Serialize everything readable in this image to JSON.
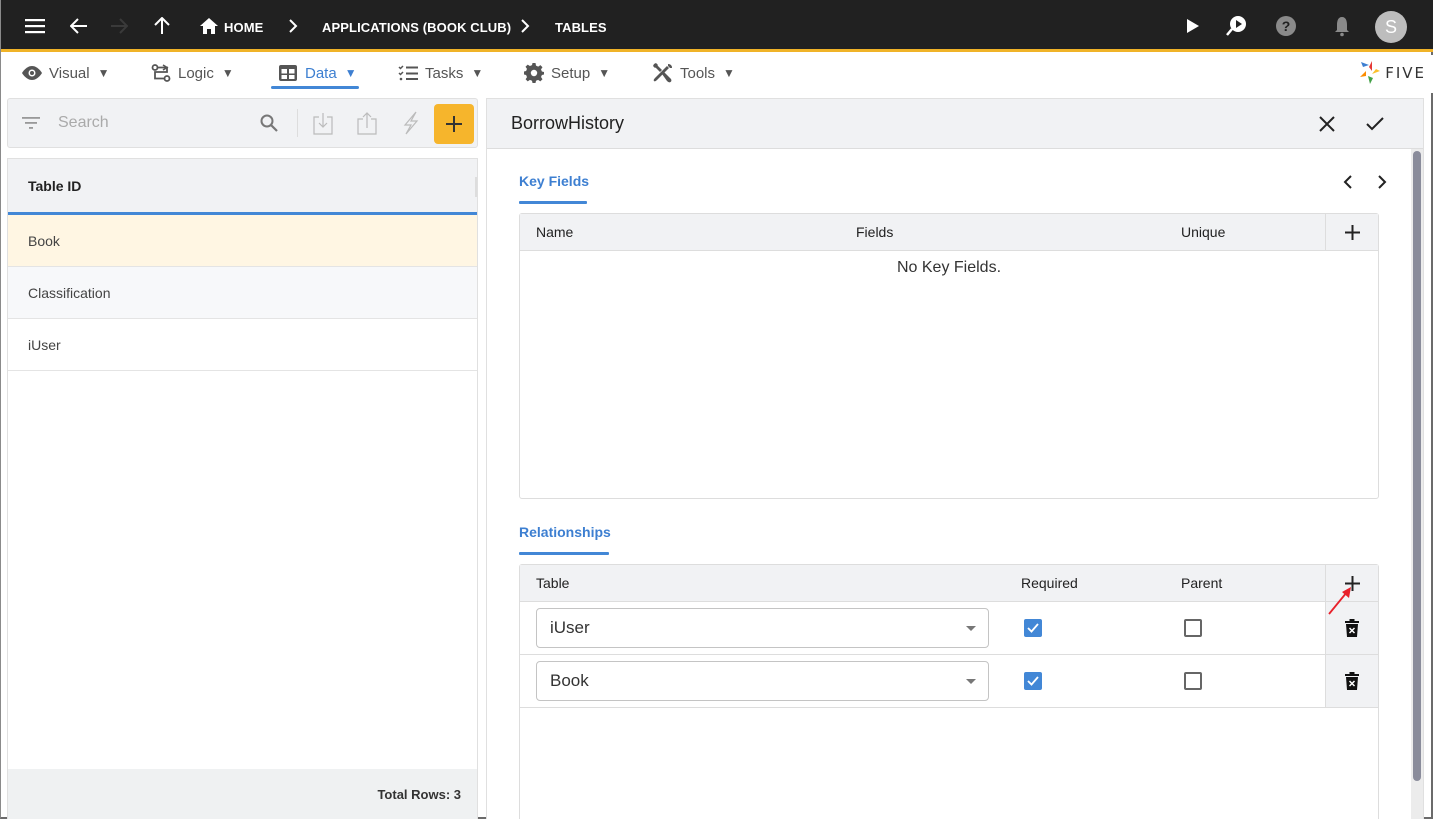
{
  "topbar": {
    "breadcrumbs": [
      {
        "label": "HOME",
        "icon": "home-icon"
      },
      {
        "label": "APPLICATIONS (BOOK CLUB)"
      },
      {
        "label": "TABLES"
      }
    ],
    "avatar_initial": "S",
    "icons": [
      "menu-icon",
      "back-arrow-icon",
      "forward-arrow-icon",
      "up-arrow-icon",
      "play-icon",
      "search-run-icon",
      "help-icon",
      "bell-icon"
    ]
  },
  "menubar": {
    "items": [
      {
        "label": "Visual",
        "icon": "eye-icon",
        "caret": "▼"
      },
      {
        "label": "Logic",
        "icon": "logic-icon",
        "caret": "▼"
      },
      {
        "label": "Data",
        "icon": "table-icon",
        "caret": "▼",
        "active": true
      },
      {
        "label": "Tasks",
        "icon": "tasks-icon",
        "caret": "▼"
      },
      {
        "label": "Setup",
        "icon": "gear-icon",
        "caret": "▼"
      },
      {
        "label": "Tools",
        "icon": "tools-icon",
        "caret": "▼"
      }
    ],
    "logo_text": "FIVE"
  },
  "left": {
    "search": {
      "placeholder": "Search",
      "value": ""
    },
    "list_header": "Table ID",
    "rows": [
      {
        "label": "Book",
        "state": "selected"
      },
      {
        "label": "Classification",
        "state": "hover"
      },
      {
        "label": "iUser",
        "state": "normal"
      }
    ],
    "footer": "Total Rows: 3"
  },
  "form": {
    "title": "BorrowHistory",
    "key_fields": {
      "tab_label": "Key Fields",
      "columns": [
        "Name",
        "Fields",
        "Unique"
      ],
      "empty_message": "No Key Fields."
    },
    "relationships": {
      "tab_label": "Relationships",
      "columns": [
        "Table",
        "Required",
        "Parent"
      ],
      "rows": [
        {
          "table": "iUser",
          "required": true,
          "parent": false
        },
        {
          "table": "Book",
          "required": true,
          "parent": false
        }
      ]
    }
  },
  "colors": {
    "accent": "#4287d6",
    "brand_yellow": "#f6b52c",
    "topbar_bg": "#212121",
    "selected_row": "#fff6e3",
    "annotation_arrow": "#e8202a"
  }
}
